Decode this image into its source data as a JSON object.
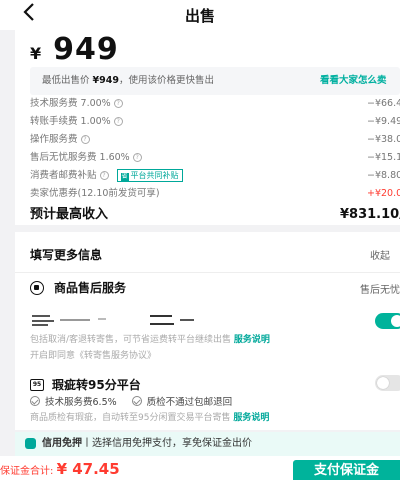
{
  "header": {
    "back_icon": "‹",
    "title": "出售"
  },
  "price": {
    "currency": "¥",
    "value": "949"
  },
  "hint": {
    "prefix": "最低出售价 ",
    "lowest": "¥949",
    "suffix": "，使用该价格更快售出",
    "link": "看看大家怎么卖"
  },
  "fees": [
    {
      "label": "技术服务费 7.00%",
      "help": true,
      "amount": "−¥66.43"
    },
    {
      "label": "转账手续费 1.00%",
      "help": true,
      "amount": "−¥9.49"
    },
    {
      "label": "操作服务费",
      "help": true,
      "amount": "−¥38.00"
    },
    {
      "label": "售后无忧服务费 1.60%",
      "help": true,
      "amount": "−¥15.18"
    },
    {
      "label": "消费者邮费补贴",
      "help": true,
      "tag": "平台共同补贴",
      "tag_icon": "省",
      "amount": "−¥8.80"
    },
    {
      "label": "卖家优惠券(12.10前发货可享)",
      "help": false,
      "amount": "+¥20.00",
      "positive": true
    }
  ],
  "income": {
    "label": "预计最高收入",
    "value": "¥831.10/件"
  },
  "more_info": {
    "title": "填写更多信息",
    "collapse": "收起"
  },
  "after_sales": {
    "title": "商品售后服务",
    "right_text": "售后无忧",
    "toggle_on": true,
    "desc_line1": "包括取消/客退转寄售，可节省运费转平台继续出售 ",
    "desc_link": "服务说明",
    "desc_line2": "开启即同意《转寄售服务协议》"
  },
  "flaw_platform": {
    "title": "瑕疵转95分平台",
    "icon_text": "95",
    "toggle_on": false,
    "option1": "技术服务费6.5%",
    "option2": "质检不通过包邮退回",
    "desc": "商品质检有瑕疵，自动转至95分闲置交易平台寄售 ",
    "desc_link": "服务说明"
  },
  "credit": {
    "bold": "信用免押",
    "text": "丨选择信用免押支付，享免保证金出价"
  },
  "bottom": {
    "deposit_label": "保证金合计: ",
    "deposit_value": "¥ 47.45",
    "pay_button": "支付保证金"
  },
  "colors": {
    "accent": "#00b39b",
    "red": "#ff3b30",
    "link": "#00a89a"
  }
}
